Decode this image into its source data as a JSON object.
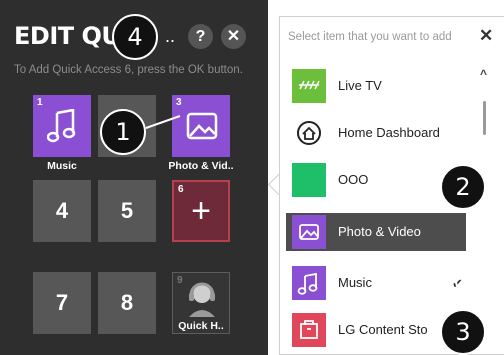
{
  "left_panel": {
    "title": "EDIT QUICK",
    "ellipsis": "..",
    "help_label": "?",
    "close_label": "✕",
    "instruction": "To Add Quick Access 6, press the OK button.",
    "tiles": [
      {
        "slot": "1",
        "label": "Music",
        "icon": "music-note-icon"
      },
      {
        "slot": "",
        "label": ""
      },
      {
        "slot": "3",
        "label": "Photo & Vid..",
        "icon": "photo-icon"
      },
      {
        "slot": "",
        "big": "4"
      },
      {
        "slot": "",
        "big": "5"
      },
      {
        "slot": "6",
        "big": "+"
      },
      {
        "slot": "",
        "big": "7"
      },
      {
        "slot": "",
        "big": "8"
      },
      {
        "slot": "9",
        "label": "Quick H..",
        "icon": "support-agent-icon"
      }
    ]
  },
  "markers": {
    "m1": "1",
    "m2": "2",
    "m3": "3",
    "m4": "4"
  },
  "right_panel": {
    "title": "Select item that you want to add",
    "close_label": "✕",
    "scroll_up": "^",
    "items": [
      {
        "label": "Live TV",
        "color": "#6cbf3a"
      },
      {
        "label": "Home Dashboard",
        "color": "#ffffff"
      },
      {
        "label": "OOO",
        "color": "#1fbf6a"
      },
      {
        "label": "Photo & Video",
        "color": "#8a4fd3",
        "highlighted": true
      },
      {
        "label": "Music",
        "color": "#8a4fd3",
        "checked": true
      },
      {
        "label": "LG Content Sto",
        "color": "#e0475a"
      }
    ],
    "checkmark": "✔"
  },
  "colors": {
    "panel_dark": "#2e2e2e",
    "purple": "#8a4fd3",
    "selected_red": "#b8404e"
  }
}
